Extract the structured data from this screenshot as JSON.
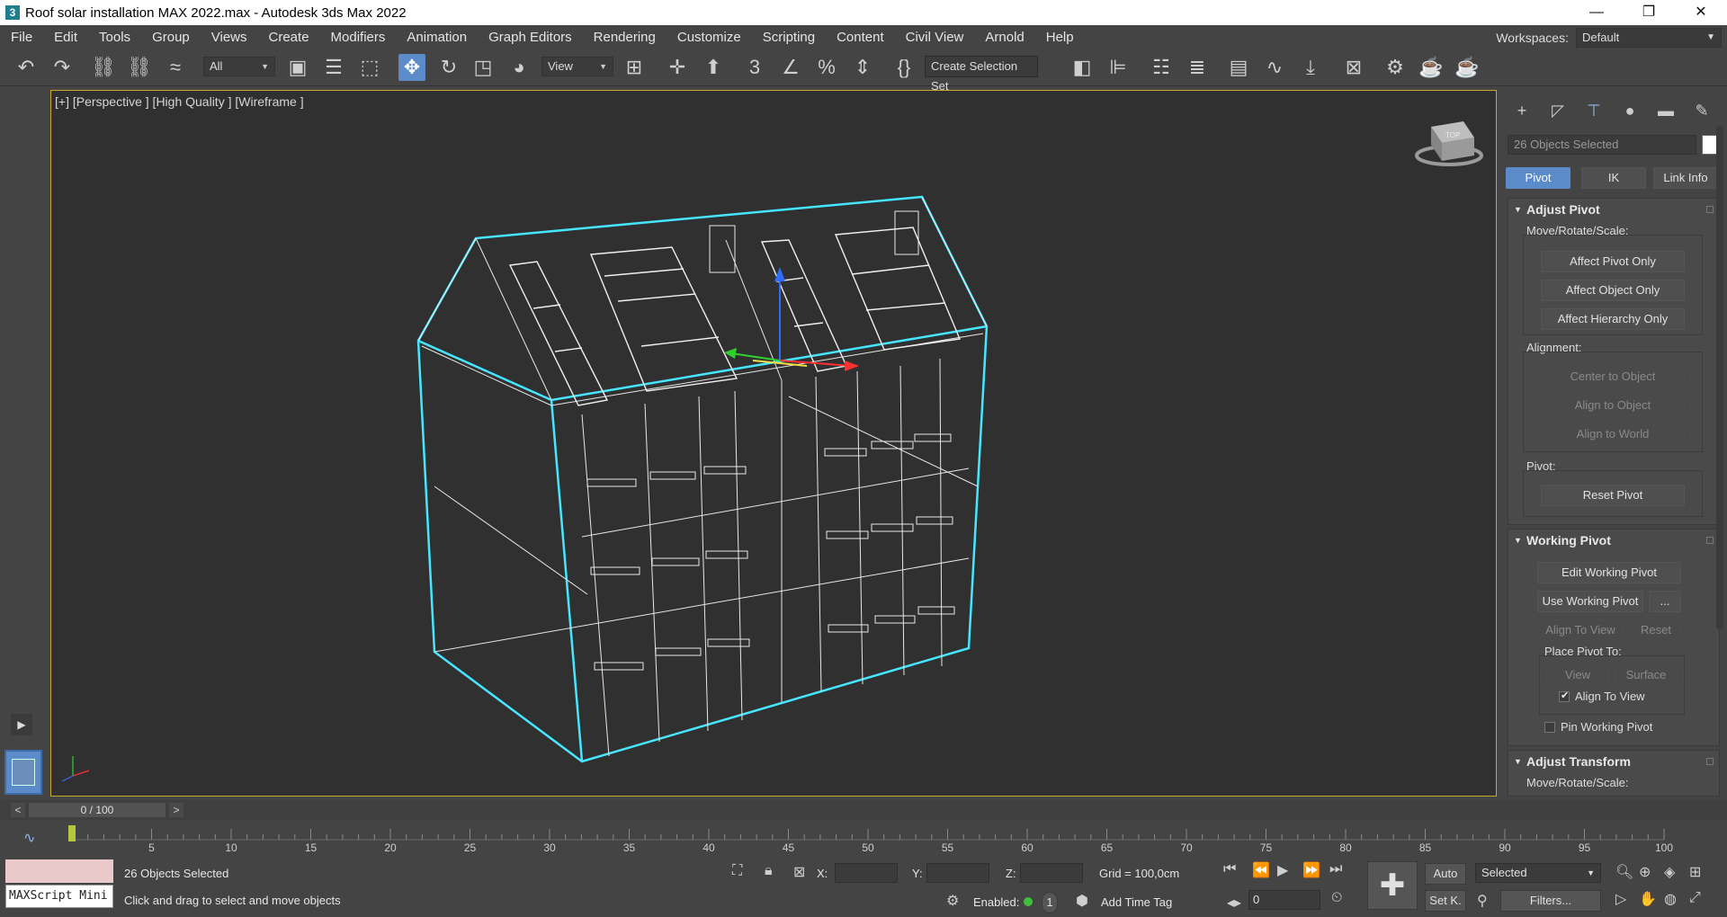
{
  "window": {
    "app_icon": "3",
    "title": "Roof solar installation MAX 2022.max - Autodesk 3ds Max 2022",
    "minimize": "—",
    "restore": "❐",
    "close": "✕"
  },
  "menu": {
    "items": [
      "File",
      "Edit",
      "Tools",
      "Group",
      "Views",
      "Create",
      "Modifiers",
      "Animation",
      "Graph Editors",
      "Rendering",
      "Customize",
      "Scripting",
      "Content",
      "Civil View",
      "Arnold",
      "Help"
    ],
    "workspaces_label": "Workspaces:",
    "workspace_value": "Default"
  },
  "toolbar": {
    "selection_filter": "All",
    "ref_coord": "View",
    "named_selection": "Create Selection Set",
    "icons": [
      "undo-icon",
      "redo-icon",
      "link-icon",
      "unlink-icon",
      "bind-spacewarp-icon",
      "select-object-icon",
      "select-by-name-icon",
      "rect-selection-icon",
      "select-move-icon",
      "select-rotate-icon",
      "select-scale-icon",
      "placement-icon",
      "pivot-center-icon",
      "select-manipulate-icon",
      "snap-toggle-icon",
      "angle-snap-icon",
      "percent-snap-icon",
      "spinner-snap-icon",
      "edit-named-sets-icon",
      "mirror-icon",
      "align-icon",
      "scene-explorer-icon",
      "layer-explorer-icon",
      "ribbon-icon",
      "curve-editor-icon",
      "schematic-view-icon",
      "material-editor-icon",
      "render-setup-icon",
      "render-frame-icon",
      "render-icon"
    ]
  },
  "viewport": {
    "label": "[+] [Perspective ] [High Quality ] [Wireframe ]",
    "viewcube_text": "TOP",
    "accent": "#c8aa2a",
    "selection_color": "#46e6ff",
    "wire_color": "#ffffff"
  },
  "command_panel": {
    "tabs": [
      "create-icon",
      "modify-icon",
      "hierarchy-icon",
      "motion-icon",
      "display-icon",
      "utilities-icon"
    ],
    "object_name": "26 Objects Selected",
    "subtabs": [
      "Pivot",
      "IK",
      "Link Info"
    ],
    "adjust_pivot": {
      "title": "Adjust Pivot",
      "mrs_label": "Move/Rotate/Scale:",
      "buttons": [
        "Affect Pivot Only",
        "Affect Object Only",
        "Affect Hierarchy Only"
      ],
      "alignment_label": "Alignment:",
      "align_buttons": [
        "Center to Object",
        "Align to Object",
        "Align to World"
      ],
      "pivot_label": "Pivot:",
      "reset_pivot": "Reset Pivot"
    },
    "working_pivot": {
      "title": "Working Pivot",
      "edit": "Edit Working Pivot",
      "use": "Use Working Pivot",
      "more": "...",
      "align_to_view": "Align To View",
      "reset": "Reset",
      "place_label": "Place Pivot To:",
      "view": "View",
      "surface": "Surface",
      "align_to_view_check": "Align To View",
      "pin": "Pin Working Pivot"
    },
    "adjust_transform": {
      "title": "Adjust Transform",
      "mrs_label": "Move/Rotate/Scale:"
    }
  },
  "timeline": {
    "prev": "<",
    "next": ">",
    "frame_display": "0 / 100",
    "ticks": [
      "5",
      "10",
      "15",
      "20",
      "25",
      "30",
      "35",
      "40",
      "45",
      "50",
      "55",
      "60",
      "65",
      "70",
      "75",
      "80",
      "85",
      "90",
      "95",
      "100"
    ]
  },
  "status": {
    "maxscript": "MAXScript Mini",
    "selected_count": "26 Objects Selected",
    "prompt": "Click and drag to select and move objects",
    "x_label": "X:",
    "y_label": "Y:",
    "z_label": "Z:",
    "grid": "Grid = 100,0cm",
    "enabled_label": "Enabled:",
    "enabled_num": "1",
    "add_time_tag": "Add Time Tag",
    "auto_btn": "Auto",
    "setk_btn": "Set K.",
    "key_filter": "Selected",
    "filters_btn": "Filters...",
    "frame_value": "0"
  }
}
